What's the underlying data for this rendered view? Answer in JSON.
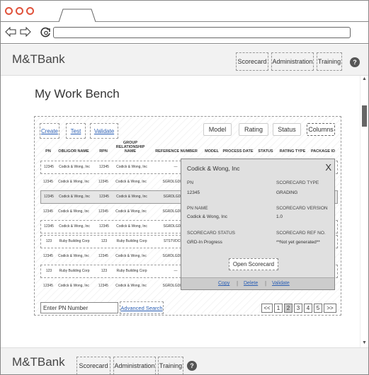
{
  "browser": {
    "dots": [
      "#e0523b",
      "#e0523b",
      "#e0523b"
    ],
    "back_icon": "back-arrow-icon",
    "forward_icon": "forward-arrow-icon",
    "reload_icon": "reload-icon"
  },
  "header": {
    "logo": "M&TBank",
    "nav": [
      "Scorecard",
      "Administration",
      "Training"
    ],
    "help": "?"
  },
  "page": {
    "title": "My Work Bench"
  },
  "toolbar": {
    "create": "Create",
    "test": "Test",
    "validate": "Validate",
    "model": "Model",
    "rating": "Rating",
    "status": "Status",
    "columns": "Columns"
  },
  "table": {
    "headers": [
      "PN",
      "OBLIGOR NAME",
      "RPN",
      "GROUP RELATIONSHIP NAME",
      "REFERENCE NUMBER",
      "MODEL",
      "PROCESS DATE",
      "STATUS",
      "RATING TYPE",
      "PACKAGE ID"
    ],
    "rows": [
      {
        "pn": "12345",
        "obligor": "Codick & Wong, Inc",
        "rpn": "12345",
        "group": "Codick & Wong, Inc",
        "ref": "—",
        "style": "boxed"
      },
      {
        "pn": "12345",
        "obligor": "Codick & Wong, Inc",
        "rpn": "12345",
        "group": "Codick & Wong, Inc",
        "ref": "SGRDLGDLGD",
        "style": "plain"
      },
      {
        "pn": "12345",
        "obligor": "Codick & Wong, Inc",
        "rpn": "12345",
        "group": "Codick & Wong, Inc",
        "ref": "SGRDLGDLGD",
        "style": "sel"
      },
      {
        "pn": "12345",
        "obligor": "Codick & Wong, Inc",
        "rpn": "12345",
        "group": "Codick & Wong, Inc",
        "ref": "SGRDLGDLGD",
        "style": "plain"
      },
      {
        "pn": "12345",
        "obligor": "Codick & Wong, Inc",
        "rpn": "12345",
        "group": "Codick & Wong, Inc",
        "ref": "SGRDLGDLGD",
        "style": "boxed"
      },
      {
        "pn": "123",
        "obligor": "Ruby Building Corp",
        "rpn": "123",
        "group": "Ruby Building Corp",
        "ref": "STSTVDCRER",
        "style": "boxed"
      },
      {
        "pn": "12345",
        "obligor": "Codick & Wong, Inc",
        "rpn": "12345",
        "group": "Codick & Wong, Inc",
        "ref": "SGRDLGDLGD",
        "style": "plain"
      },
      {
        "pn": "123",
        "obligor": "Ruby Building Corp",
        "rpn": "123",
        "group": "Ruby Building Corp",
        "ref": "—",
        "style": "boxed"
      },
      {
        "pn": "12345",
        "obligor": "Codick & Wong, Inc",
        "rpn": "12345",
        "group": "Codick & Wong, Inc",
        "ref": "SGRDLGDLGD",
        "style": "plain"
      }
    ]
  },
  "search": {
    "pn_placeholder": "Enter PN Number",
    "advanced": "Advanced Search"
  },
  "pagination": [
    "<<",
    "1",
    "2",
    "3",
    "4",
    "5",
    ">>"
  ],
  "pagination_current": "2",
  "popup": {
    "title": "Codick & Wong, Inc",
    "close": "X",
    "pn_label": "PN",
    "pn_value": "12345",
    "type_label": "SCORECARD TYPE",
    "type_value": "GRADING",
    "name_label": "PN NAME",
    "name_value": "Codick & Wong, Inc",
    "version_label": "SCORECARD VERSION",
    "version_value": "1.0",
    "status_label": "SCORECARD STATUS",
    "status_value": "GRD-In Progress",
    "ref_label": "SCORECARD REF NO.",
    "ref_value": "**Not yet generated**",
    "open": "Open Scorecard",
    "copy": "Copy",
    "delete": "Delete",
    "validate": "Validate",
    "sep": "|"
  },
  "footer": {
    "logo": "M&TBank",
    "nav": [
      "Scorecard",
      "Administration",
      "Training"
    ],
    "help": "?"
  },
  "colors": {
    "link": "#2b5fb4",
    "traffic_light": "#e0523b",
    "header_bg": "#f2f2f2",
    "popup_bg": "#e0e0e0"
  }
}
